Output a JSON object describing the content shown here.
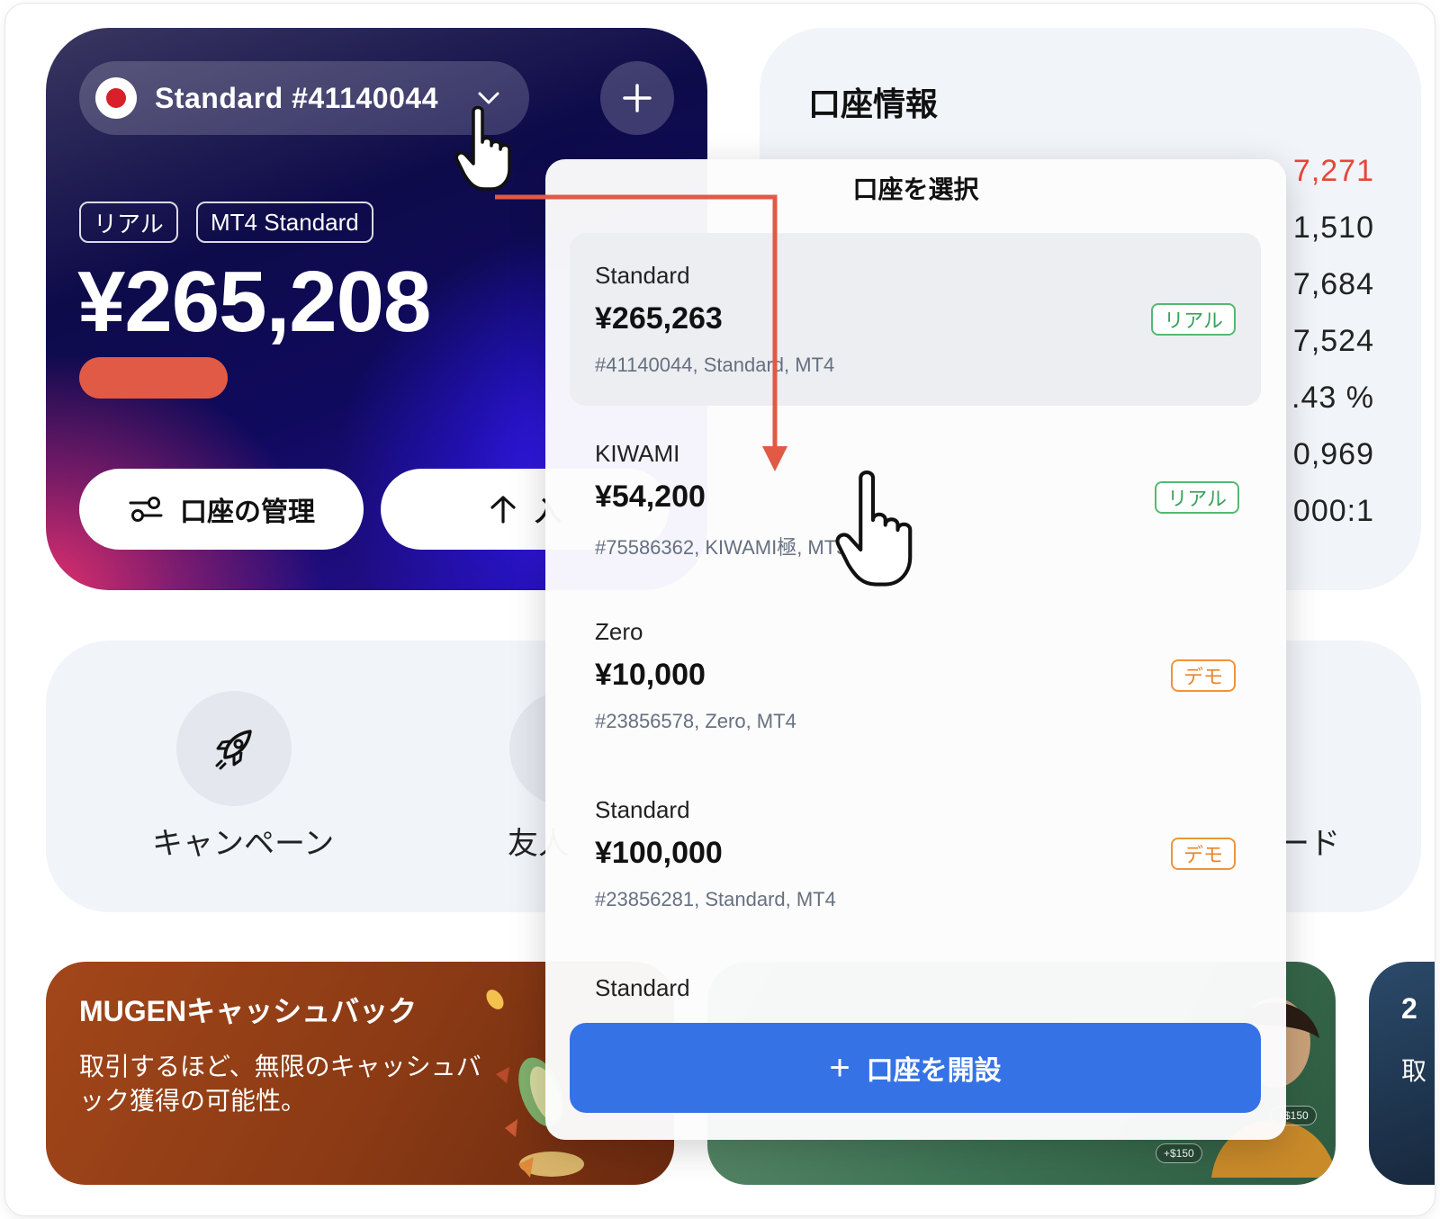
{
  "account_card": {
    "selected_account": "Standard #41140044",
    "tags": [
      "リアル",
      "MT4 Standard"
    ],
    "balance": "¥265,208",
    "manage_button": "口座の管理",
    "deposit_button": "入"
  },
  "info_card": {
    "title": "口座情報",
    "values": [
      "7,271",
      "1,510",
      "7,684",
      "7,524",
      ".43 %",
      "0,969",
      "000:1"
    ],
    "highlight_color": "#e5473a"
  },
  "shortcuts": {
    "items": [
      "キャンペーン",
      "友人",
      "ード"
    ]
  },
  "banners": {
    "cashback_title": "MUGENキャッシュバック",
    "cashback_text": "取引するほど、無限のキャッシュバック獲得の可能性。",
    "chip1": "+$150",
    "chip2": "+$150",
    "third_num": "2",
    "third_text": "取"
  },
  "dropdown": {
    "title": "口座を選択",
    "accounts": [
      {
        "type": "Standard",
        "balance": "¥265,263",
        "meta": "#41140044, Standard, MT4",
        "badge": "リアル"
      },
      {
        "type": "KIWAMI",
        "balance": "¥54,200",
        "meta": "#75586362, KIWAMI極, MT5",
        "badge": "リアル"
      },
      {
        "type": "Zero",
        "balance": "¥10,000",
        "meta": "#23856578, Zero, MT4",
        "badge": "デモ"
      },
      {
        "type": "Standard",
        "balance": "¥100,000",
        "meta": "#23856281, Standard, MT4",
        "badge": "デモ"
      },
      {
        "type": "Standard"
      }
    ],
    "open_button": "口座を開設"
  },
  "colors": {
    "primary_blue": "#3572e6",
    "real_green": "#3aa15c",
    "demo_orange": "#e8852a",
    "annotation_red": "#e05a45"
  }
}
